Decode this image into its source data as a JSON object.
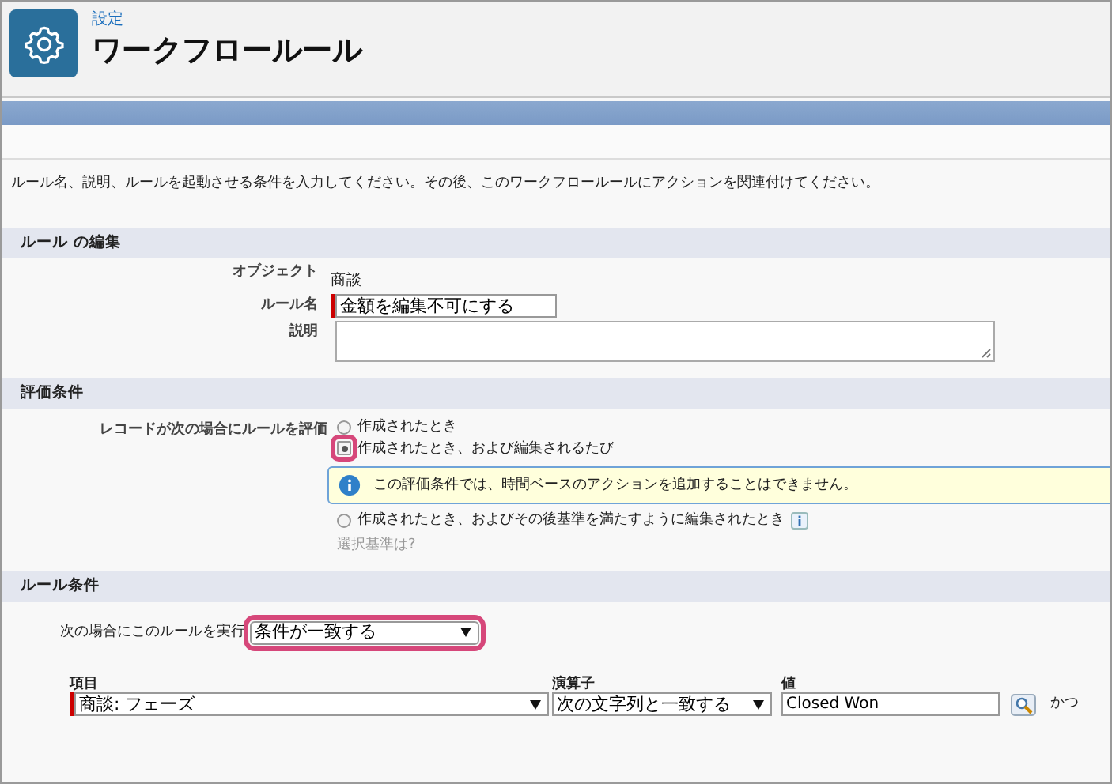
{
  "header": {
    "breadcrumb": "設定",
    "title": "ワークフロールール"
  },
  "intro": "ルール名、説明、ルールを起動させる条件を入力してください。その後、このワークフロールールにアクションを関連付けてください。",
  "edit_section": {
    "title": "ルール の編集",
    "fields": [
      {
        "label": "オブジェクト",
        "kind": "text",
        "value": "商談"
      },
      {
        "label": "ルール名",
        "kind": "input",
        "value": "金額を編集不可にする",
        "required": true
      },
      {
        "label": "説明",
        "kind": "textarea"
      }
    ]
  },
  "evaluation": {
    "title": "評価条件",
    "label": "レコードが次の場合にルールを評価",
    "options": [
      {
        "label": "作成されたとき",
        "selected": false,
        "highlighted": false,
        "help": false
      },
      {
        "label": "作成されたとき、および編集されるたび",
        "selected": true,
        "highlighted": true,
        "help": false,
        "note": "この評価条件では、時間ベースのアクションを追加することはできません。"
      },
      {
        "label": "作成されたとき、およびその後基準を満たすように編集されたとき",
        "selected": false,
        "highlighted": false,
        "help": true
      }
    ],
    "help_link": "選択基準は?"
  },
  "criteria": {
    "title": "ルール条件",
    "run_label": "次の場合にこのルールを実行",
    "run_select": {
      "value": "条件が一致する",
      "highlighted": true
    },
    "columns": [
      "項目",
      "演算子",
      "値"
    ],
    "rows": [
      {
        "field": "商談: フェーズ",
        "operator": "次の文字列と一致する",
        "value": "Closed Won",
        "conjunction": "かつ",
        "required": true
      }
    ]
  }
}
